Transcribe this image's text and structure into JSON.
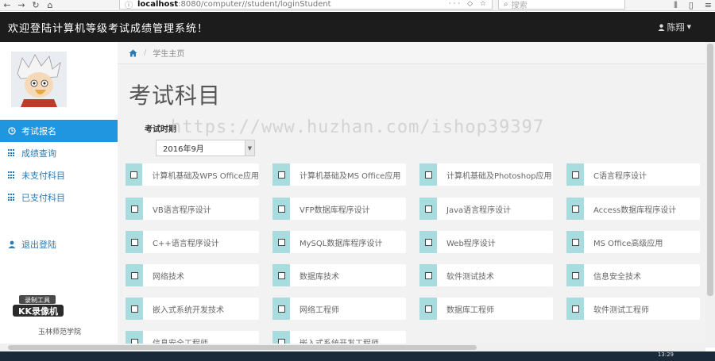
{
  "browser": {
    "url_host": "localhost",
    "url_path": ":8080/computer//student/loginStudent",
    "url_tools": "··· ◇ ☆",
    "search_placeholder": "搜索"
  },
  "navbar": {
    "title": "欢迎登陆计算机等级考试成绩管理系统！",
    "user_name": "陈翔"
  },
  "sidebar": {
    "items": [
      {
        "label": "考试报名",
        "active": true
      },
      {
        "label": "成绩查询",
        "active": false
      },
      {
        "label": "未支付科目",
        "active": false
      },
      {
        "label": "已支付科目",
        "active": false
      }
    ],
    "logout": "退出登陆",
    "school": "玉林师范学院"
  },
  "breadcrumb": {
    "current": "学生主页"
  },
  "main": {
    "title": "考试科目",
    "term_label": "考试时期",
    "term_value": "2016年9月"
  },
  "subjects": [
    "计算机基础及WPS Office应用",
    "计算机基础及MS Office应用",
    "计算机基础及Photoshop应用",
    "C语言程序设计",
    "VB语言程序设计",
    "VFP数据库程序设计",
    "Java语言程序设计",
    "Access数据库程序设计",
    "C++语言程序设计",
    "MySQL数据库程序设计",
    "Web程序设计",
    "MS Office高级应用",
    "网络技术",
    "数据库技术",
    "软件测试技术",
    "信息安全技术",
    "嵌入式系统开发技术",
    "网络工程师",
    "数据库工程师",
    "软件测试工程师",
    "信息安全工程师",
    "嵌入式系统开发工程师"
  ],
  "taskbar": {
    "clock": "13:29"
  },
  "watermark": "https://www.huzhan.com/ishop39397",
  "colors": {
    "navbar": "#1c1c1c",
    "active_menu": "#2196e0",
    "checkbox_bg": "#a9dcdf",
    "link": "#2a7ab8"
  }
}
